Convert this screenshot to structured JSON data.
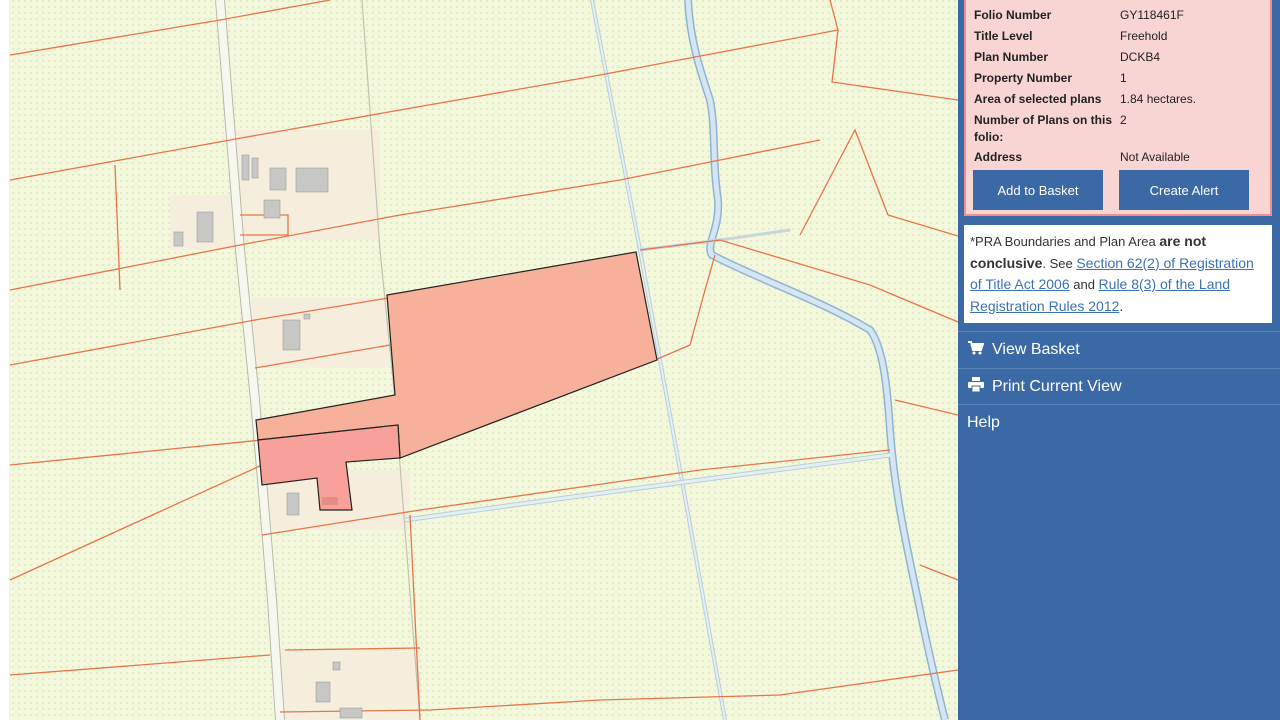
{
  "folio": {
    "rows": [
      {
        "label": "Folio Number",
        "value": "GY118461F"
      },
      {
        "label": "Title Level",
        "value": "Freehold"
      },
      {
        "label": "Plan Number",
        "value": "DCKB4"
      },
      {
        "label": "Property Number",
        "value": "1"
      },
      {
        "label": "Area of selected plans",
        "value": "1.84 hectares."
      },
      {
        "label": "Number of Plans on this folio:",
        "value": "2"
      },
      {
        "label": "Address",
        "value": "Not Available"
      }
    ],
    "add_to_basket": "Add to Basket",
    "create_alert": "Create Alert"
  },
  "disclaimer": {
    "prefix": "*PRA Boundaries and Plan Area ",
    "bold": "are not conclusive",
    "mid": ". See ",
    "link1": "Section 62(2) of Registration of Title Act 2006",
    "and": " and ",
    "link2": "Rule 8(3) of the Land Registration Rules 2012",
    "suffix": "."
  },
  "menu": {
    "view_basket": "View Basket",
    "print_view": "Print Current View",
    "help": "Help"
  },
  "colors": {
    "sidebar": "#3a69a5",
    "panel_bg": "#f8d4d3",
    "panel_border": "#f08f8c",
    "map_bg": "#f3f8dc",
    "boundary": "#e8744a",
    "selected_plot": "#f7b09a",
    "water": "#cfe3f2"
  },
  "icons": {
    "basket": "shopping-cart-icon",
    "print": "printer-icon"
  }
}
